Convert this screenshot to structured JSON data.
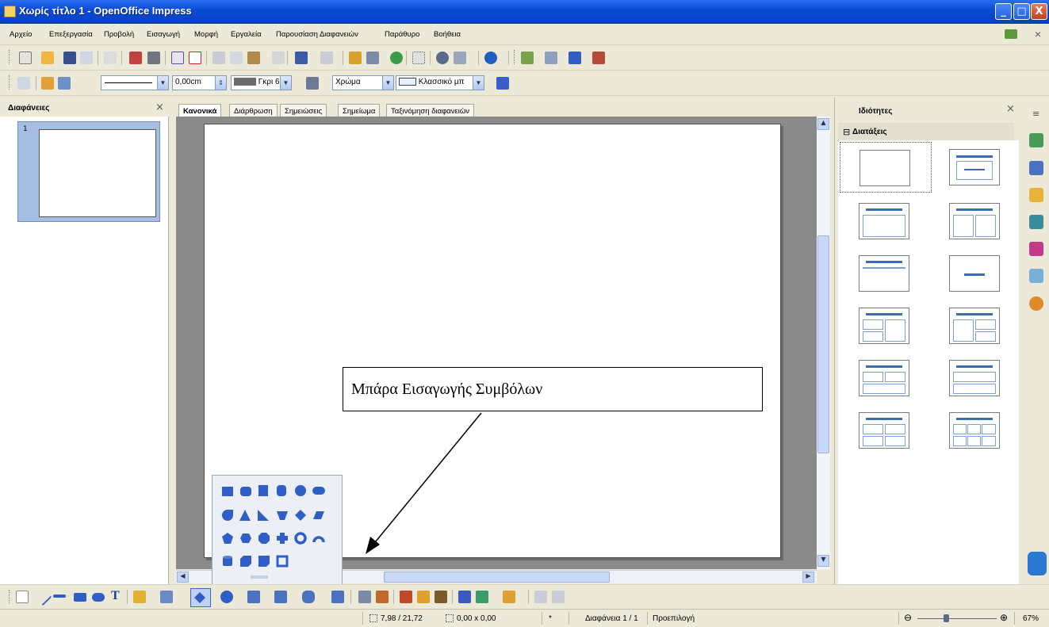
{
  "window": {
    "title": "Χωρίς τίτλο 1 - OpenOffice Impress",
    "min": "_",
    "max": "□",
    "close": "X"
  },
  "menu": [
    "Αρχείο",
    "Επεξεργασία",
    "Προβολή",
    "Εισαγωγή",
    "Μορφή",
    "Εργαλεία",
    "Παρουσίαση Διαφανειών",
    "Παράθυρο",
    "Βοήθεια"
  ],
  "menu_close": "×",
  "line_toolbar": {
    "line_width_value": "0,00cm",
    "line_color_value": "Γκρι 6",
    "area_style_value": "Χρώμα",
    "area_fill_value": "Κλασσικό μπ"
  },
  "slides_panel": {
    "title": "Διαφάνειες",
    "close": "×",
    "slide_number": "1"
  },
  "tabs": [
    "Κανονικά",
    "Διάρθρωση",
    "Σημειώσεις",
    "Σημείωμα",
    "Ταξινόμηση διαφανειών"
  ],
  "properties": {
    "title": "Ιδιότητες",
    "close": "×",
    "menu": "≡",
    "section": "Διατάξεις",
    "collapse": "⊟"
  },
  "callout": {
    "text": "Μπάρα Εισαγωγής Συμβόλων"
  },
  "status": {
    "position": "7,98 / 21,72",
    "size": "0,00 x 0,00",
    "modified": "*",
    "slide": "Διαφάνεια 1 / 1",
    "layout": "Προεπιλογή",
    "zoom": "67%"
  },
  "colors": {
    "accent": "#2f5fc6",
    "titlebar": "#0a4bd6"
  }
}
